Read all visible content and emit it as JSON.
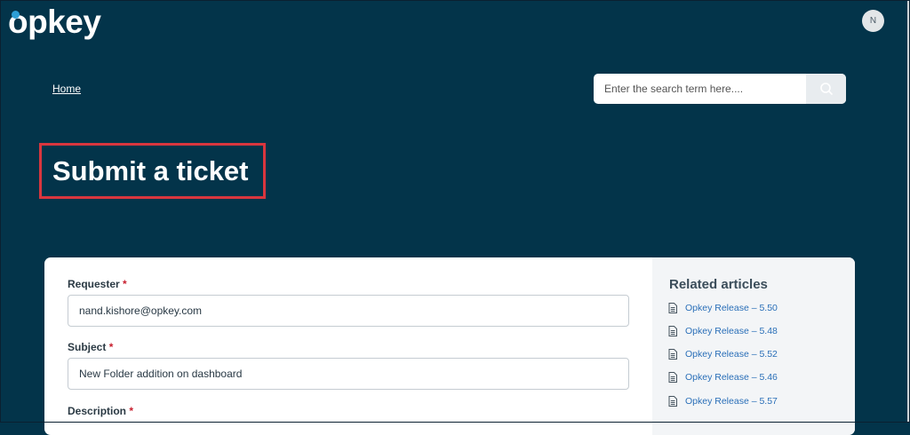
{
  "header": {
    "logo_text": "opkey",
    "avatar_initial": "N"
  },
  "breadcrumb": {
    "home_label": "Home"
  },
  "search": {
    "placeholder": "Enter the search term here...."
  },
  "page": {
    "title": "Submit a ticket"
  },
  "form": {
    "requester": {
      "label": "Requester",
      "value": "nand.kishore@opkey.com"
    },
    "subject": {
      "label": "Subject",
      "value": "New Folder addition on dashboard"
    },
    "description": {
      "label": "Description"
    },
    "required_marker": "*"
  },
  "related": {
    "title": "Related articles",
    "items": [
      {
        "label": "Opkey Release – 5.50"
      },
      {
        "label": "Opkey Release – 5.48"
      },
      {
        "label": "Opkey Release – 5.52"
      },
      {
        "label": "Opkey Release – 5.46"
      },
      {
        "label": "Opkey Release – 5.57"
      }
    ]
  },
  "colors": {
    "header_bg": "#03344a",
    "highlight_border": "#d9363e",
    "link": "#2a6fb8",
    "required": "#c8202f"
  }
}
